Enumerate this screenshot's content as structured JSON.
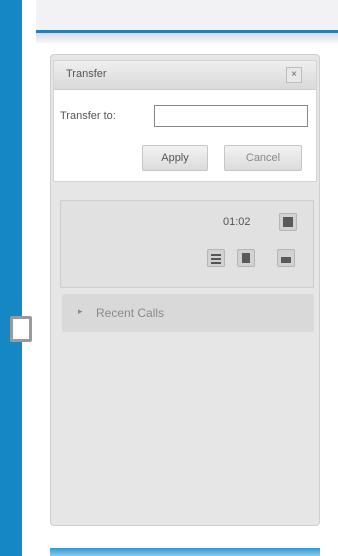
{
  "transfer": {
    "title": "Transfer",
    "close_label": "×",
    "to_label": "Transfer to:",
    "input_value": "",
    "apply_label": "Apply",
    "cancel_label": "Cancel"
  },
  "call": {
    "timer": "01:02"
  },
  "recent_calls": {
    "arrow": "▸",
    "label": "Recent Calls"
  },
  "colors": {
    "frame_blue": "#1687c5",
    "panel_gray": "#e6e6e6"
  }
}
